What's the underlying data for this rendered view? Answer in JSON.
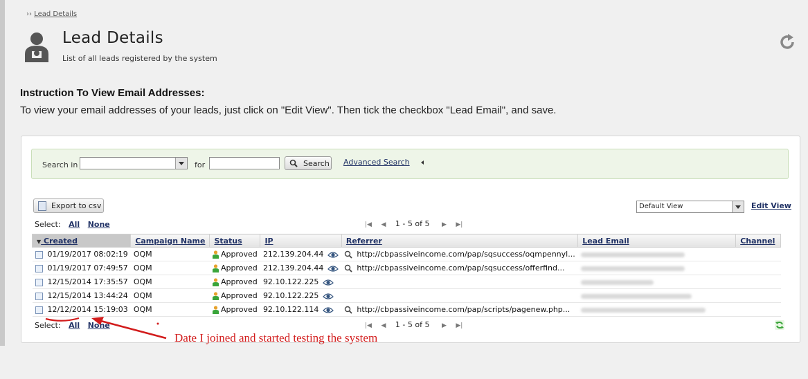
{
  "breadcrumb": {
    "prefix": "››",
    "link": "Lead Details"
  },
  "header": {
    "title": "Lead Details",
    "subtitle": "List of all leads registered by the system"
  },
  "instructions": {
    "title": "Instruction To View Email Addresses:",
    "text": "To view your email addresses of your leads, just click on \"Edit View\". Then tick the checkbox \"Lead Email\", and save."
  },
  "search": {
    "search_in_label": "Search in",
    "for_label": "for",
    "button": "Search",
    "advanced": "Advanced Search"
  },
  "toolbar": {
    "export": "Export to csv",
    "view_selected": "Default View",
    "edit_view": "Edit View"
  },
  "selection": {
    "label": "Select:",
    "all": "All",
    "none": "None"
  },
  "pager": {
    "info": "1 - 5 of 5"
  },
  "table": {
    "columns": [
      "Created",
      "Campaign Name",
      "Status",
      "IP",
      "Referrer",
      "Lead Email",
      "Channel"
    ],
    "rows": [
      {
        "created": "01/19/2017 08:02:19",
        "campaign": "OQM",
        "status": "Approved",
        "ip": "212.139.204.44",
        "referrer": "http://cbpassiveincome.com/pap/sqsuccess/oqmpennyl..."
      },
      {
        "created": "01/19/2017 07:49:57",
        "campaign": "OQM",
        "status": "Approved",
        "ip": "212.139.204.44",
        "referrer": "http://cbpassiveincome.com/pap/sqsuccess/offerfind..."
      },
      {
        "created": "12/15/2014 17:35:57",
        "campaign": "OQM",
        "status": "Approved",
        "ip": "92.10.122.225",
        "referrer": ""
      },
      {
        "created": "12/15/2014 13:44:24",
        "campaign": "OQM",
        "status": "Approved",
        "ip": "92.10.122.225",
        "referrer": ""
      },
      {
        "created": "12/12/2014 15:19:03",
        "campaign": "OQM",
        "status": "Approved",
        "ip": "92.10.122.114",
        "referrer": "http://cbpassiveincome.com/pap/scripts/pagenew.php..."
      }
    ]
  },
  "annotation": {
    "text": "Date I joined and started testing the system",
    "color": "#d21c1c"
  },
  "colors": {
    "link": "#223366",
    "search_panel_bg": "#eef5e8",
    "accent_green": "#3aa53a"
  }
}
